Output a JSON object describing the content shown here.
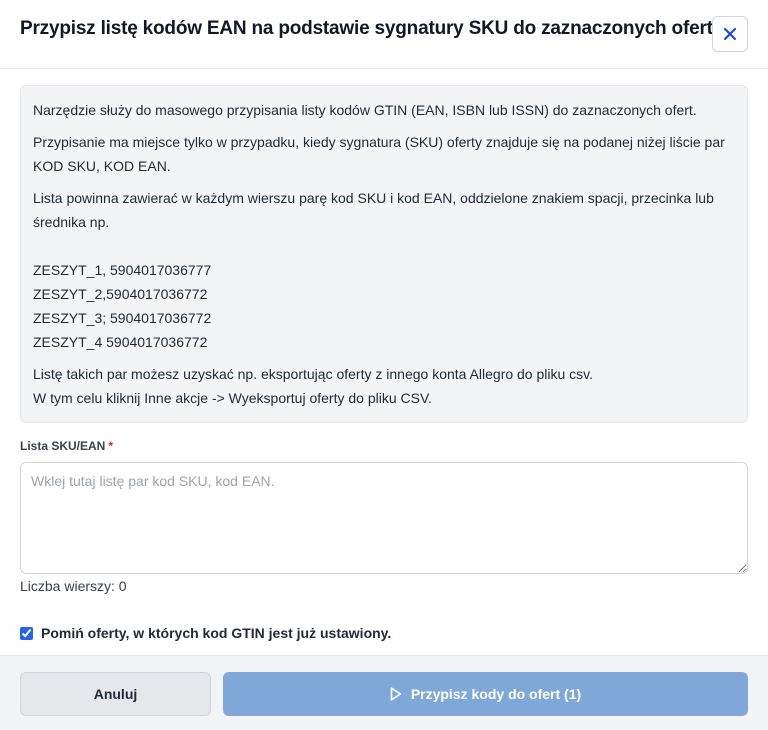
{
  "dialog": {
    "title": "Przypisz listę kodów EAN na podstawie sygnatury SKU do zaznaczonych ofert",
    "close_icon": "close-icon"
  },
  "info": {
    "p1": "Narzędzie służy do masowego przypisania listy kodów GTIN (EAN, ISBN lub ISSN) do zaznaczonych ofert.",
    "p2": "Przypisanie ma miejsce tylko w przypadku, kiedy sygnatura (SKU) oferty znajduje się na podanej niżej liście par KOD SKU, KOD EAN.",
    "p3": "Lista powinna zawierać w każdym wierszu parę kod SKU i kod EAN, oddzielone znakiem spacji, przecinka lub średnika np.",
    "examples": [
      "ZESZYT_1, 5904017036777",
      "ZESZYT_2,5904017036772",
      "ZESZYT_3; 5904017036772",
      "ZESZYT_4 5904017036772"
    ],
    "p4_line1": "Listę takich par możesz uzyskać np. eksportując oferty z innego konta Allegro do pliku csv.",
    "p4_line2": "W tym celu kliknij Inne akcje -> Wyeksportuj oferty do pliku CSV."
  },
  "form": {
    "label": "Lista SKU/EAN",
    "required_mark": "*",
    "value": "",
    "placeholder": "Wklej tutaj listę par kod SKU, kod EAN.",
    "row_count_label": "Liczba wierszy: 0",
    "skip_checkbox_label": "Pomiń oferty, w których kod GTIN jest już ustawiony.",
    "skip_checked": true
  },
  "footer": {
    "cancel_label": "Anuluj",
    "assign_label": "Przypisz kody do ofert (1)",
    "assign_icon": "play-icon"
  },
  "colors": {
    "primary_disabled": "#7fa8d8",
    "close_icon": "#1d4ed8",
    "required": "#dc2626"
  }
}
